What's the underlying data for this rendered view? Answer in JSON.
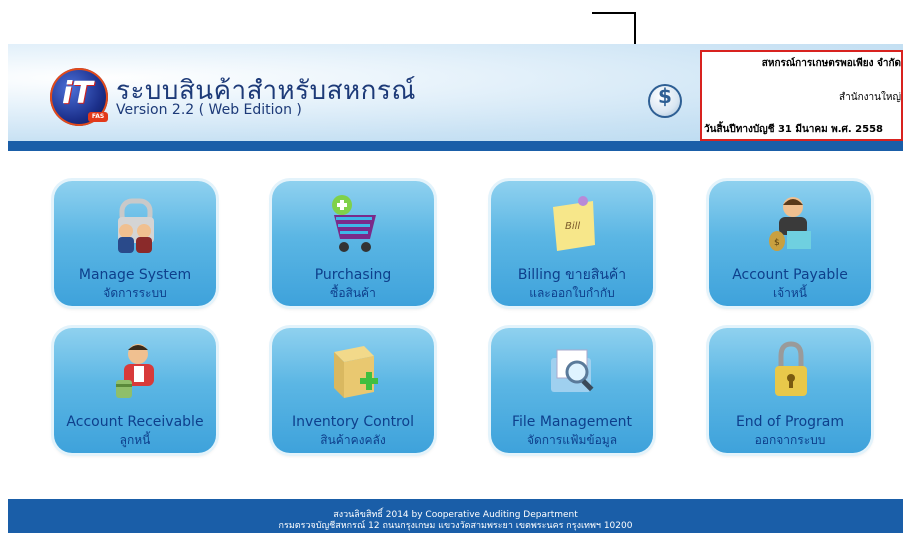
{
  "header": {
    "app_title": "ระบบสินค้าสำหรับสหกรณ์",
    "version": "Version 2.2 ( Web Edition )",
    "logo_text": "iT",
    "logo_badge": "FAS",
    "currency_symbol": "$",
    "coop_name": "สหกรณ์การเกษตรพอเพียง จำกัด",
    "office": "สำนักงานใหญ่",
    "fiscal_year_end": "วันสิ้นปีทางบัญชี 31 มีนาคม พ.ศ. 2558"
  },
  "menu": [
    {
      "label": "Manage System",
      "sub": "จัดการระบบ",
      "icon": "people-lock-icon"
    },
    {
      "label": "Purchasing",
      "sub": "ซื้อสินค้า",
      "icon": "shopping-cart-icon"
    },
    {
      "label": "Billing ขายสินค้า",
      "sub": "และออกใบกำกับ",
      "icon": "bill-note-icon"
    },
    {
      "label": "Account Payable",
      "sub": "เจ้าหนี้",
      "icon": "money-person-icon"
    },
    {
      "label": "Account Receivable",
      "sub": "ลูกหนี้",
      "icon": "person-money-icon"
    },
    {
      "label": "Inventory Control",
      "sub": "สินค้าคงคลัง",
      "icon": "box-add-icon"
    },
    {
      "label": "File Management",
      "sub": "จัดการแฟ้มข้อมูล",
      "icon": "folder-search-icon"
    },
    {
      "label": "End of Program",
      "sub": "ออกจากระบบ",
      "icon": "padlock-icon"
    }
  ],
  "footer": {
    "line1": "สงวนลิขสิทธิ์ 2014 by Cooperative Auditing Department",
    "line2": "กรมตรวจบัญชีสหกรณ์ 12 ถนนกรุงเกษม แขวงวัดสามพระยา เขตพระนคร กรุงเทพฯ 10200"
  },
  "colors": {
    "accent": "#1a5ea8",
    "tile": "#5bb6e4",
    "annotation": "#d8221f"
  }
}
